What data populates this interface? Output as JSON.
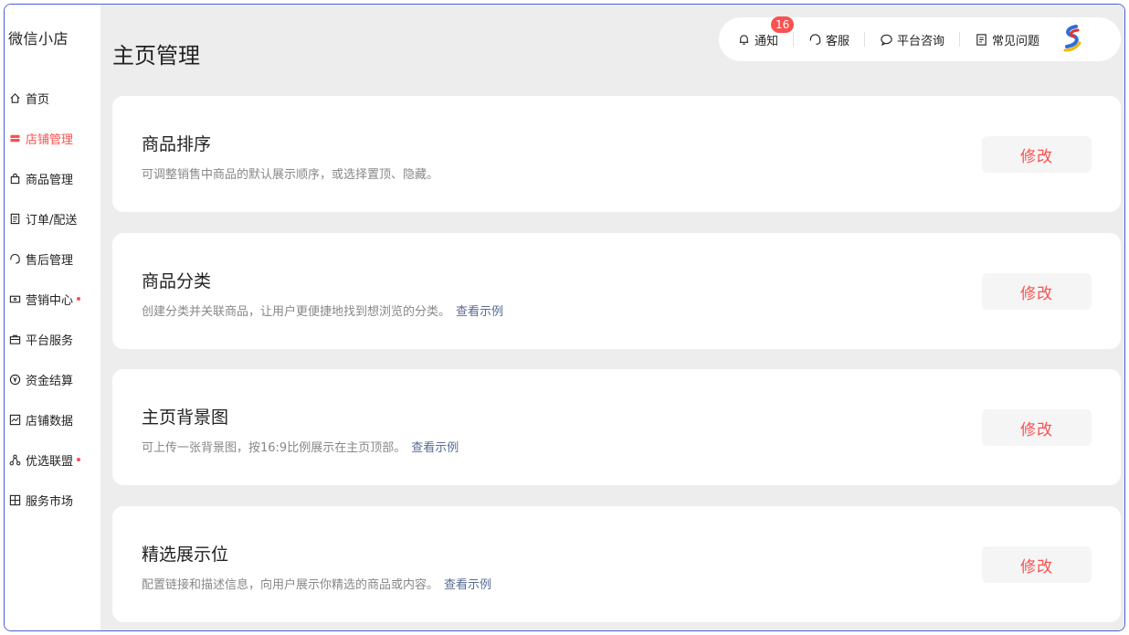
{
  "app": {
    "title": "微信小店"
  },
  "sidebar": {
    "items": [
      {
        "label": "首页",
        "icon": "home-icon"
      },
      {
        "label": "店铺管理",
        "icon": "store-icon",
        "active": true
      },
      {
        "label": "商品管理",
        "icon": "shopping-bag-icon"
      },
      {
        "label": "订单/配送",
        "icon": "order-icon"
      },
      {
        "label": "售后管理",
        "icon": "headset-icon"
      },
      {
        "label": "营销中心",
        "icon": "ticket-icon",
        "dot": true
      },
      {
        "label": "平台服务",
        "icon": "briefcase-icon"
      },
      {
        "label": "资金结算",
        "icon": "yen-icon"
      },
      {
        "label": "店铺数据",
        "icon": "chart-icon"
      },
      {
        "label": "优选联盟",
        "icon": "network-icon",
        "dot": true
      },
      {
        "label": "服务市场",
        "icon": "grid-icon"
      }
    ]
  },
  "header": {
    "page_title": "主页管理",
    "notify_label": "通知",
    "notify_count": "16",
    "service_label": "客服",
    "consult_label": "平台咨询",
    "faq_label": "常见问题"
  },
  "cards": [
    {
      "title": "商品排序",
      "desc": "可调整销售中商品的默认展示顺序，或选择置顶、隐藏。",
      "link": "",
      "button": "修改"
    },
    {
      "title": "商品分类",
      "desc": "创建分类并关联商品，让用户更便捷地找到想浏览的分类。",
      "link": "查看示例",
      "button": "修改"
    },
    {
      "title": "主页背景图",
      "desc": "可上传一张背景图，按16:9比例展示在主页顶部。",
      "link": "查看示例",
      "button": "修改"
    },
    {
      "title": "精选展示位",
      "desc": "配置链接和描述信息，向用户展示你精选的商品或内容。",
      "link": "查看示例",
      "button": "修改"
    }
  ],
  "colors": {
    "accent": "#fa5151",
    "link": "#576b95",
    "background": "#ededed",
    "border": "#4a5fd6"
  }
}
